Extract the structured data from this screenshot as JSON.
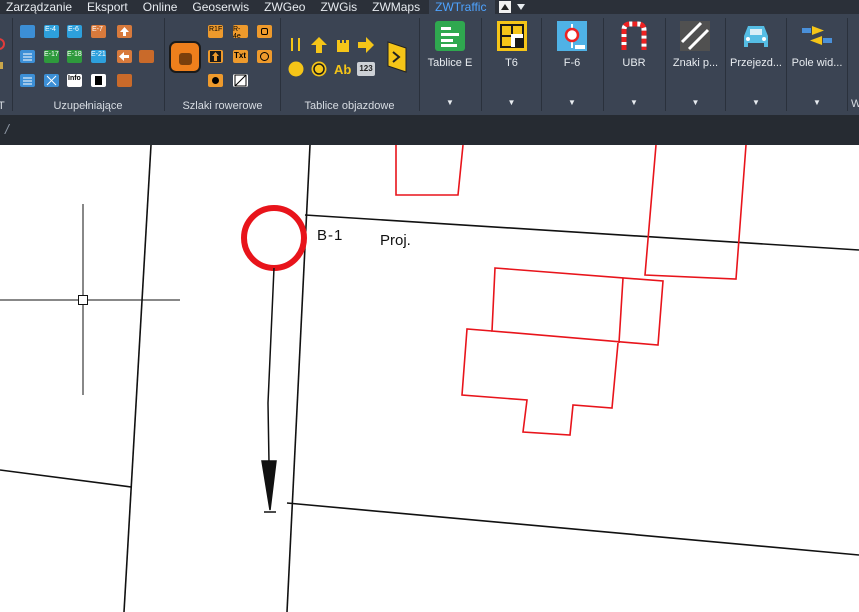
{
  "menu": {
    "tabs": [
      "Zarządzanie",
      "Eksport",
      "Online",
      "Geoserwis",
      "ZWGeo",
      "ZWGis",
      "ZWMaps",
      "ZWTraffic"
    ],
    "active_tab": "ZWTraffic"
  },
  "ribbon": {
    "panels": {
      "partial_left": "T",
      "uzupelniajace": "Uzupełniające",
      "szlaki": "Szlaki rowerowe",
      "objazdowe": "Tablice objazdowe",
      "partial_right": "W"
    },
    "small_icon_labels": {
      "e4": "E-4",
      "e6": "E-6",
      "e7": "E-7",
      "e17": "E-17",
      "e18": "E-18",
      "e21": "E-21",
      "info": "Info",
      "r1f": "R1F",
      "r4e": "R-4e",
      "txt": "Txt",
      "b123": "123",
      "ab": "Ab"
    },
    "big_buttons": [
      {
        "id": "tablice-e",
        "label": "Tablice E"
      },
      {
        "id": "t6",
        "label": "T6"
      },
      {
        "id": "f6",
        "label": "F-6"
      },
      {
        "id": "ubr",
        "label": "UBR"
      },
      {
        "id": "znaki",
        "label": "Znaki p..."
      },
      {
        "id": "przejezdzie",
        "label": "Przejezd..."
      },
      {
        "id": "pole",
        "label": "Pole wid..."
      }
    ],
    "colors": {
      "ribbon_bg": "#3b4453",
      "accent": "#4ea3ff",
      "menu_bg": "#2b3039"
    }
  },
  "drawing": {
    "sign_label": "B-1",
    "proj_label": "Proj.",
    "colors": {
      "building": "#e8141b",
      "sign_ring": "#e8141b",
      "line": "#111111"
    }
  }
}
